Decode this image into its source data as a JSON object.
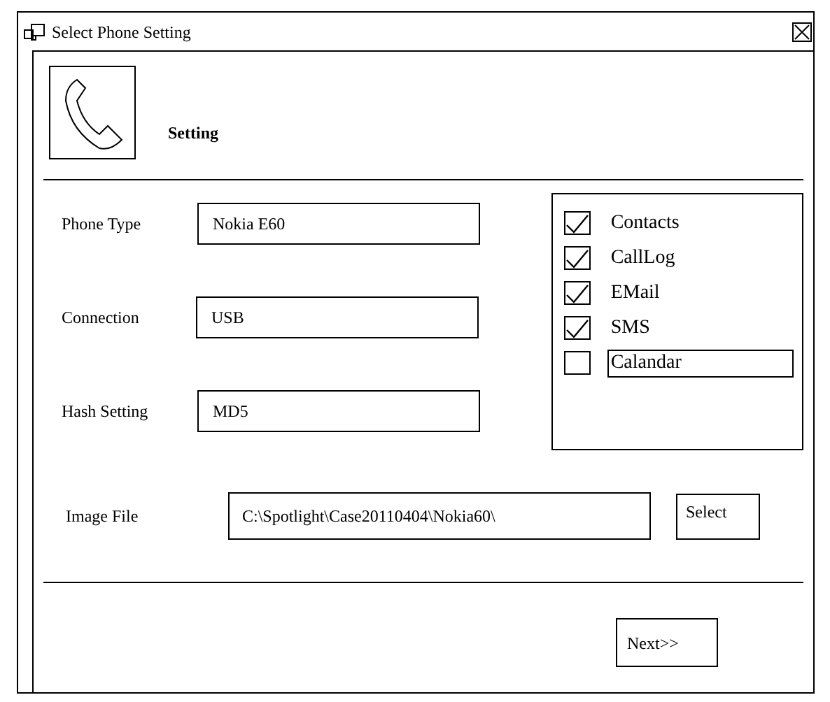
{
  "window": {
    "title": "Select Phone Setting"
  },
  "header": {
    "title": "Setting"
  },
  "fields": [
    {
      "label": "Phone Type",
      "value": "Nokia E60"
    },
    {
      "label": "Connection",
      "value": "USB"
    },
    {
      "label": "Hash Setting",
      "value": "MD5"
    }
  ],
  "options": [
    {
      "label": "Contacts",
      "checked": true,
      "selected": false
    },
    {
      "label": "CallLog",
      "checked": true,
      "selected": false
    },
    {
      "label": "EMail",
      "checked": true,
      "selected": false
    },
    {
      "label": "SMS",
      "checked": true,
      "selected": false
    },
    {
      "label": "Calandar",
      "checked": false,
      "selected": true
    }
  ],
  "image_file": {
    "label": "Image File",
    "value": "C:\\Spotlight\\Case20110404\\Nokia60\\",
    "button": "Select"
  },
  "next_button": "Next>>"
}
